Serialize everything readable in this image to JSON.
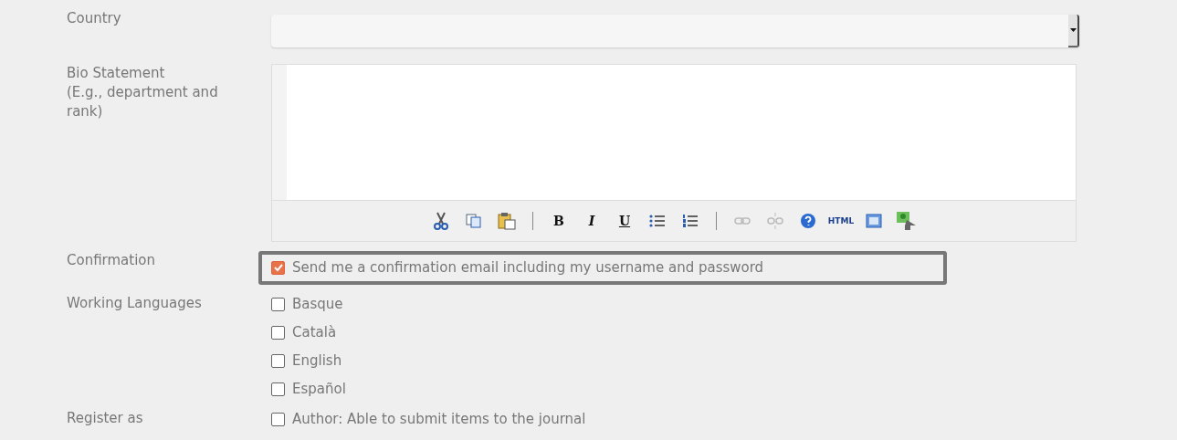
{
  "fields": [
    {
      "kind": "select",
      "label": "Country"
    },
    {
      "kind": "editor",
      "label": "Bio Statement",
      "hint": "(E.g., department and rank)",
      "tools": [
        {
          "kind": "cut"
        },
        {
          "kind": "copy"
        },
        {
          "kind": "paste"
        },
        {
          "kind": "separator"
        },
        {
          "kind": "bold",
          "label": "B"
        },
        {
          "kind": "italic",
          "label": "I"
        },
        {
          "kind": "underline",
          "label": "U"
        },
        {
          "kind": "bullets"
        },
        {
          "kind": "numbers"
        },
        {
          "kind": "separator"
        },
        {
          "kind": "link",
          "disabled": true
        },
        {
          "kind": "unlink",
          "disabled": true
        },
        {
          "kind": "help"
        },
        {
          "kind": "small",
          "label": "HTML"
        },
        {
          "kind": "fullscreen"
        },
        {
          "kind": "image"
        }
      ]
    },
    {
      "kind": "checks",
      "label": "Confirmation",
      "highlighted": true,
      "options": [
        {
          "label": "Send me a confirmation email including my username and password",
          "checked": true
        }
      ]
    },
    {
      "kind": "checks",
      "label": "Working Languages",
      "highlighted": false,
      "options": [
        {
          "label": "Basque",
          "checked": false
        },
        {
          "label": "Català",
          "checked": false
        },
        {
          "label": "English",
          "checked": false
        },
        {
          "label": "Español",
          "checked": false
        }
      ]
    },
    {
      "kind": "checks",
      "label": "Register as",
      "highlighted": false,
      "options": [
        {
          "label": "Author: Able to submit items to the journal",
          "checked": false
        }
      ]
    }
  ]
}
